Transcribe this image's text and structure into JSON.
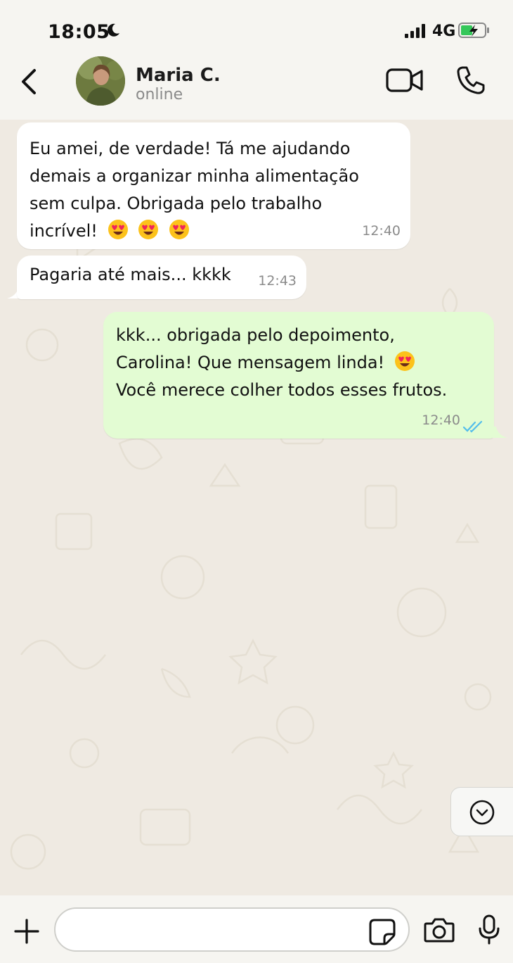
{
  "status_bar": {
    "time": "18:05",
    "network": "4G",
    "icons": [
      "moon-icon",
      "signal-icon",
      "battery-charging-icon"
    ]
  },
  "header": {
    "contact_name": "Maria C.",
    "contact_status": "online",
    "icons": [
      "back-chevron-icon",
      "video-call-icon",
      "phone-call-icon"
    ]
  },
  "messages": [
    {
      "direction": "incoming",
      "lines": [
        "Eu amei, de verdade! Tá me ajudando",
        "demais a organizar minha alimentação",
        "sem culpa. Obrigada pelo trabalho",
        "incrível!"
      ],
      "emojis": 3,
      "time": "12:40"
    },
    {
      "direction": "incoming",
      "lines": [
        "Pagaria até mais... kkkk"
      ],
      "emojis": 0,
      "time": "12:43"
    },
    {
      "direction": "outgoing",
      "lines": [
        "kkk... obrigada pelo depoimento,",
        "Carolina! Que mensagem linda!",
        "Você merece colher todos esses frutos."
      ],
      "emojis": 1,
      "time": "12:40",
      "read": true
    }
  ],
  "input": {
    "value": "",
    "placeholder": ""
  },
  "colors": {
    "incoming_bubble": "#ffffff",
    "outgoing_bubble": "#e3fcd3",
    "read_ticks": "#53bdeb",
    "chat_background": "#efeae2"
  }
}
